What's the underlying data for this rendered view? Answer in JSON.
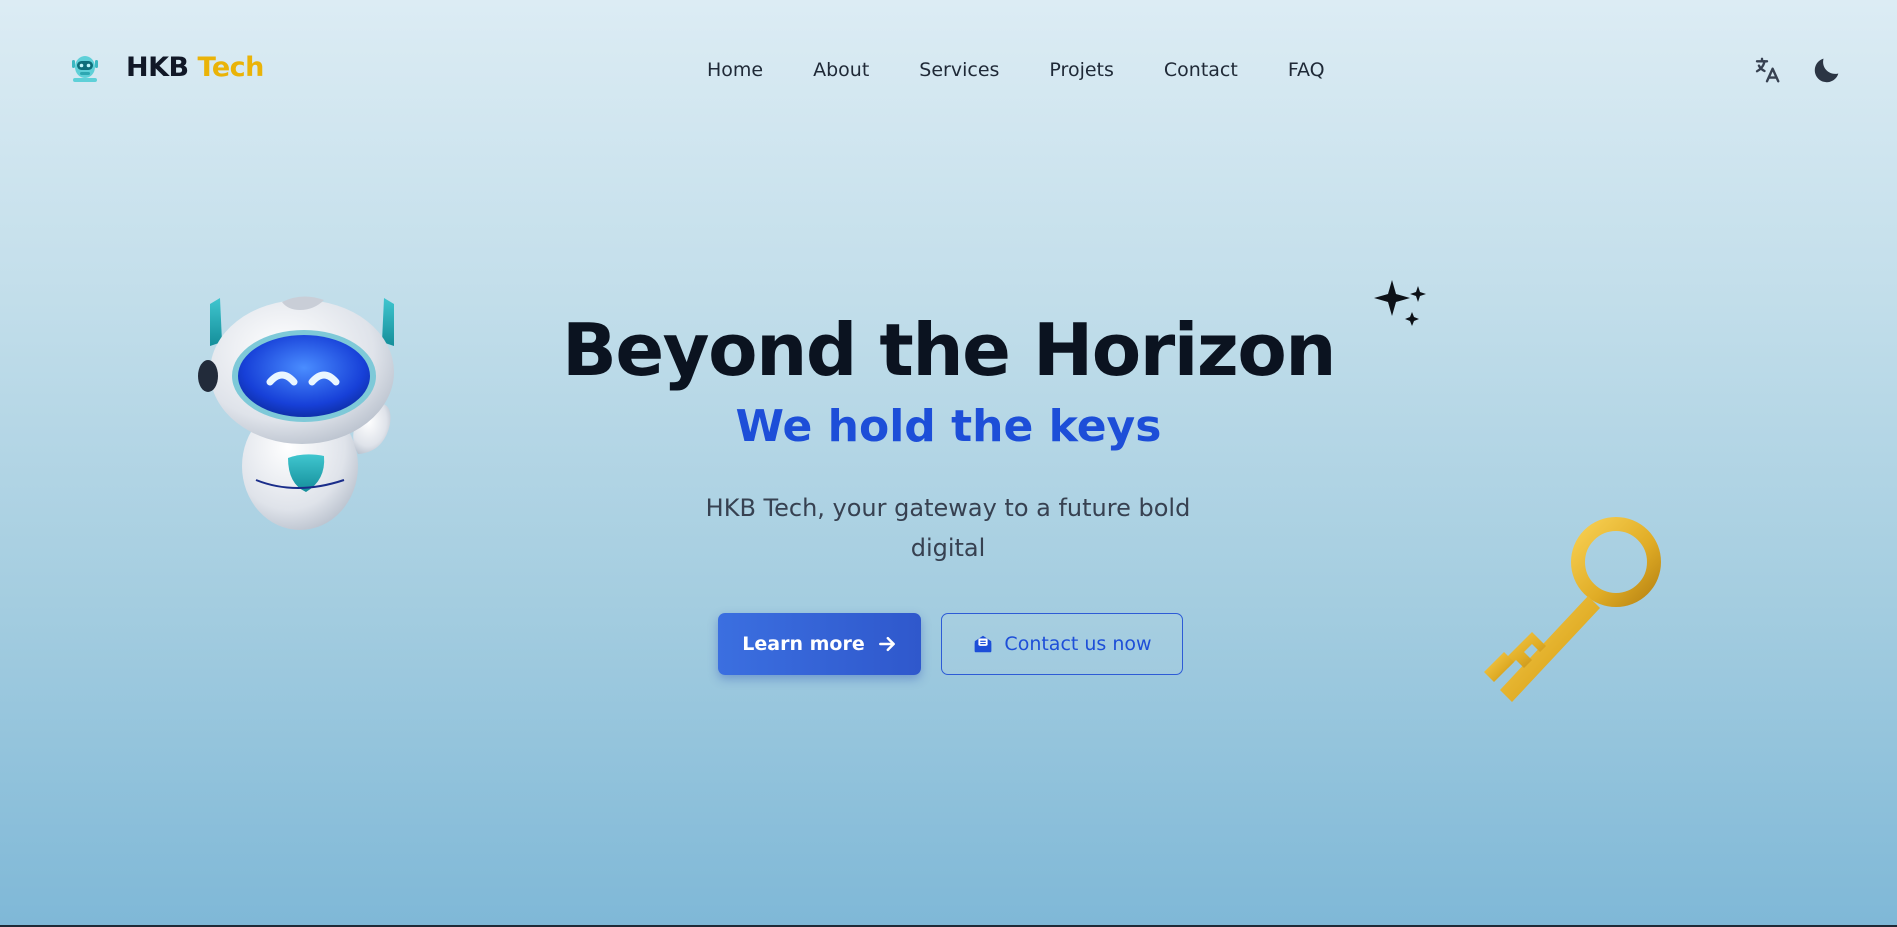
{
  "brand": {
    "name_main": "HKB",
    "name_accent": "Tech",
    "logo_icon": "robot-logo-icon",
    "accent_color": "#eab308"
  },
  "nav": {
    "items": [
      {
        "label": "Home"
      },
      {
        "label": "About"
      },
      {
        "label": "Services"
      },
      {
        "label": "Projets"
      },
      {
        "label": "Contact"
      },
      {
        "label": "FAQ"
      }
    ]
  },
  "header_actions": {
    "language_icon": "translate-icon",
    "theme_icon": "moon-icon"
  },
  "hero": {
    "title": "Beyond the Horizon",
    "subtitle": "We hold the keys",
    "description": "HKB Tech, your gateway to a future bold digital",
    "primary_cta": {
      "label": "Learn more",
      "icon": "arrow-right-icon"
    },
    "secondary_cta": {
      "label": "Contact us now",
      "icon": "envelope-open-icon"
    },
    "subtitle_color": "#1d4ed8",
    "primary_color": "#2f58cc"
  },
  "decorations": {
    "left": "waving-robot-illustration",
    "top_right": "sparkles-icon",
    "bottom_right": "golden-key-illustration"
  }
}
